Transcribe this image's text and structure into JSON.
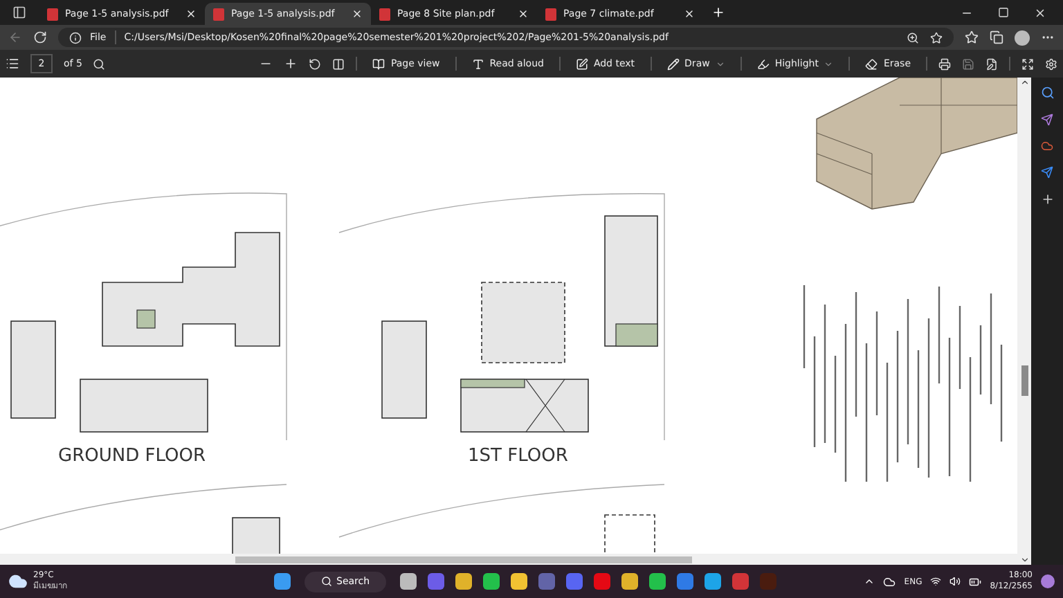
{
  "tabs": [
    {
      "title": "Page 1-5 analysis.pdf",
      "selected": false
    },
    {
      "title": "Page 1-5 analysis.pdf",
      "selected": true
    },
    {
      "title": "Page 8 Site plan.pdf",
      "selected": false
    },
    {
      "title": "Page 7 climate.pdf",
      "selected": false
    }
  ],
  "address": {
    "scheme": "File",
    "url": "C:/Users/Msi/Desktop/Kosen%20final%20page%20semester%201%20project%202/Page%201-5%20analysis.pdf"
  },
  "toolbar": {
    "page": "2",
    "of": "of 5",
    "buttons": [
      {
        "kind": "pageview",
        "label": "Page view"
      },
      {
        "kind": "read",
        "label": "Read aloud"
      },
      {
        "kind": "addtext",
        "label": "Add text"
      },
      {
        "kind": "draw",
        "label": "Draw"
      },
      {
        "kind": "highlight",
        "label": "Highlight"
      },
      {
        "kind": "erase",
        "label": "Erase"
      }
    ]
  },
  "document": {
    "labels": [
      "GROUND FLOOR",
      "1ST FLOOR"
    ]
  },
  "taskbar": {
    "temperature": "29°C",
    "weather": "มีเมฆมาก",
    "search": "Search",
    "language": "ENG",
    "time": "18:00",
    "date": "8/12/2565"
  }
}
